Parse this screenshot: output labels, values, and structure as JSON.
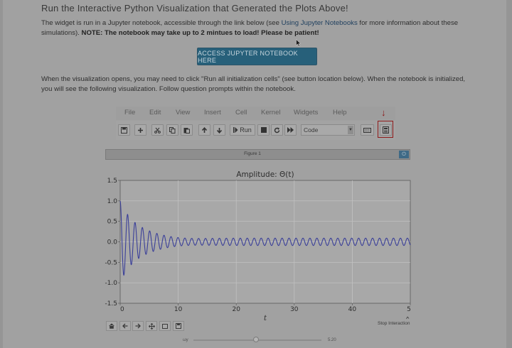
{
  "section": {
    "heading": "Run the Interactive Python Visualization that Generated the Plots Above!",
    "intro_text": "The widget is run in a Jupyter notebook, accessible through the link below (see ",
    "intro_link": "Using Jupyter Notebooks",
    "intro_text_2": " for more information about these simulations). ",
    "note_bold": "NOTE: The notebook may take up to 2 mintues to load! Please be patient!",
    "cta_label": "ACCESS JUPYTER NOTEBOOK HERE",
    "instructions": "When the visualization opens, you may need to click \"Run all initialization cells\" (see button location below). When the notebook is initialized, you will see the following visualization. Follow question prompts within the notebook."
  },
  "notebook": {
    "menu": [
      "File",
      "Edit",
      "View",
      "Insert",
      "Cell",
      "Kernel",
      "Widgets",
      "Help"
    ],
    "run_label": "Run",
    "cell_type": "Code",
    "toolbar_icons": [
      "save-icon",
      "plus-icon",
      "cut-icon",
      "copy-icon",
      "paste-icon",
      "arrow-up-icon",
      "arrow-down-icon",
      "step-run-icon",
      "stop-icon",
      "restart-icon",
      "fast-forward-icon",
      "keyboard-icon",
      "init-cells-icon"
    ],
    "highlight_color": "#8f1a1a"
  },
  "figure": {
    "title": "Figure 1",
    "stop_label": "Stop Interaction",
    "nav_icons": [
      "home-icon",
      "back-icon",
      "forward-icon",
      "pan-icon",
      "zoom-icon",
      "save-figure-icon"
    ],
    "slider": {
      "label": "ωy",
      "value_text": "5.20",
      "fraction": 0.49
    }
  },
  "chart_data": {
    "type": "line",
    "title": "Amplitude: Θ(t)",
    "xlabel": "t",
    "ylabel": "",
    "xlim": [
      0,
      50
    ],
    "ylim": [
      -1.5,
      1.5
    ],
    "x_ticks": [
      "0",
      "10",
      "20",
      "30",
      "40",
      "5"
    ],
    "y_ticks": [
      "1.5",
      "1.0",
      "0.5",
      "0.0",
      "-0.5",
      "-1.0",
      "-1.5"
    ],
    "grid": true,
    "line_color": "#3a3f99",
    "series": [
      {
        "transient_amplitude": 1.0,
        "transient_decay_time": 3.0,
        "transient_period": 1.27,
        "steady_amplitude": 0.09,
        "steady_period": 1.2
      }
    ]
  }
}
